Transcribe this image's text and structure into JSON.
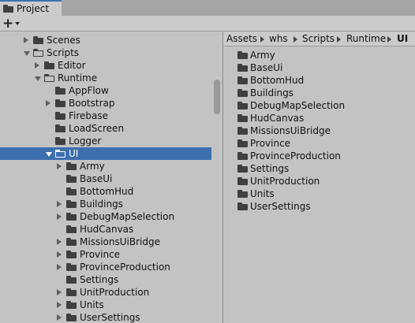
{
  "tab": {
    "label": "Project"
  },
  "toolbar": {
    "create_symbol": "+"
  },
  "tree": [
    {
      "label": "Scenes",
      "depth": 0,
      "arrow": "right",
      "folder": "closed"
    },
    {
      "label": "Scripts",
      "depth": 0,
      "arrow": "down",
      "folder": "open"
    },
    {
      "label": "Editor",
      "depth": 1,
      "arrow": "right",
      "folder": "closed"
    },
    {
      "label": "Runtime",
      "depth": 1,
      "arrow": "down",
      "folder": "open"
    },
    {
      "label": "AppFlow",
      "depth": 2,
      "arrow": "none",
      "folder": "closed"
    },
    {
      "label": "Bootstrap",
      "depth": 2,
      "arrow": "right",
      "folder": "closed"
    },
    {
      "label": "Firebase",
      "depth": 2,
      "arrow": "none",
      "folder": "closed"
    },
    {
      "label": "LoadScreen",
      "depth": 2,
      "arrow": "none",
      "folder": "closed"
    },
    {
      "label": "Logger",
      "depth": 2,
      "arrow": "none",
      "folder": "closed"
    },
    {
      "label": "UI",
      "depth": 2,
      "arrow": "down",
      "folder": "open",
      "selected": true
    },
    {
      "label": "Army",
      "depth": 3,
      "arrow": "right",
      "folder": "closed"
    },
    {
      "label": "BaseUi",
      "depth": 3,
      "arrow": "none",
      "folder": "closed"
    },
    {
      "label": "BottomHud",
      "depth": 3,
      "arrow": "none",
      "folder": "closed"
    },
    {
      "label": "Buildings",
      "depth": 3,
      "arrow": "right",
      "folder": "closed"
    },
    {
      "label": "DebugMapSelection",
      "depth": 3,
      "arrow": "right",
      "folder": "closed"
    },
    {
      "label": "HudCanvas",
      "depth": 3,
      "arrow": "none",
      "folder": "closed"
    },
    {
      "label": "MissionsUiBridge",
      "depth": 3,
      "arrow": "right",
      "folder": "closed"
    },
    {
      "label": "Province",
      "depth": 3,
      "arrow": "right",
      "folder": "closed"
    },
    {
      "label": "ProvinceProduction",
      "depth": 3,
      "arrow": "right",
      "folder": "closed"
    },
    {
      "label": "Settings",
      "depth": 3,
      "arrow": "none",
      "folder": "closed"
    },
    {
      "label": "UnitProduction",
      "depth": 3,
      "arrow": "right",
      "folder": "closed"
    },
    {
      "label": "Units",
      "depth": 3,
      "arrow": "right",
      "folder": "closed"
    },
    {
      "label": "UserSettings",
      "depth": 3,
      "arrow": "right",
      "folder": "closed"
    }
  ],
  "breadcrumb": [
    "Assets",
    "whs",
    "Scripts",
    "Runtime",
    "UI"
  ],
  "content": [
    "Army",
    "BaseUi",
    "BottomHud",
    "Buildings",
    "DebugMapSelection",
    "HudCanvas",
    "MissionsUiBridge",
    "Province",
    "ProvinceProduction",
    "Settings",
    "UnitProduction",
    "Units",
    "UserSettings"
  ],
  "colors": {
    "selection": "#3d6fae",
    "tab_accent": "#3a72b0",
    "panel": "#c3c3c3"
  }
}
